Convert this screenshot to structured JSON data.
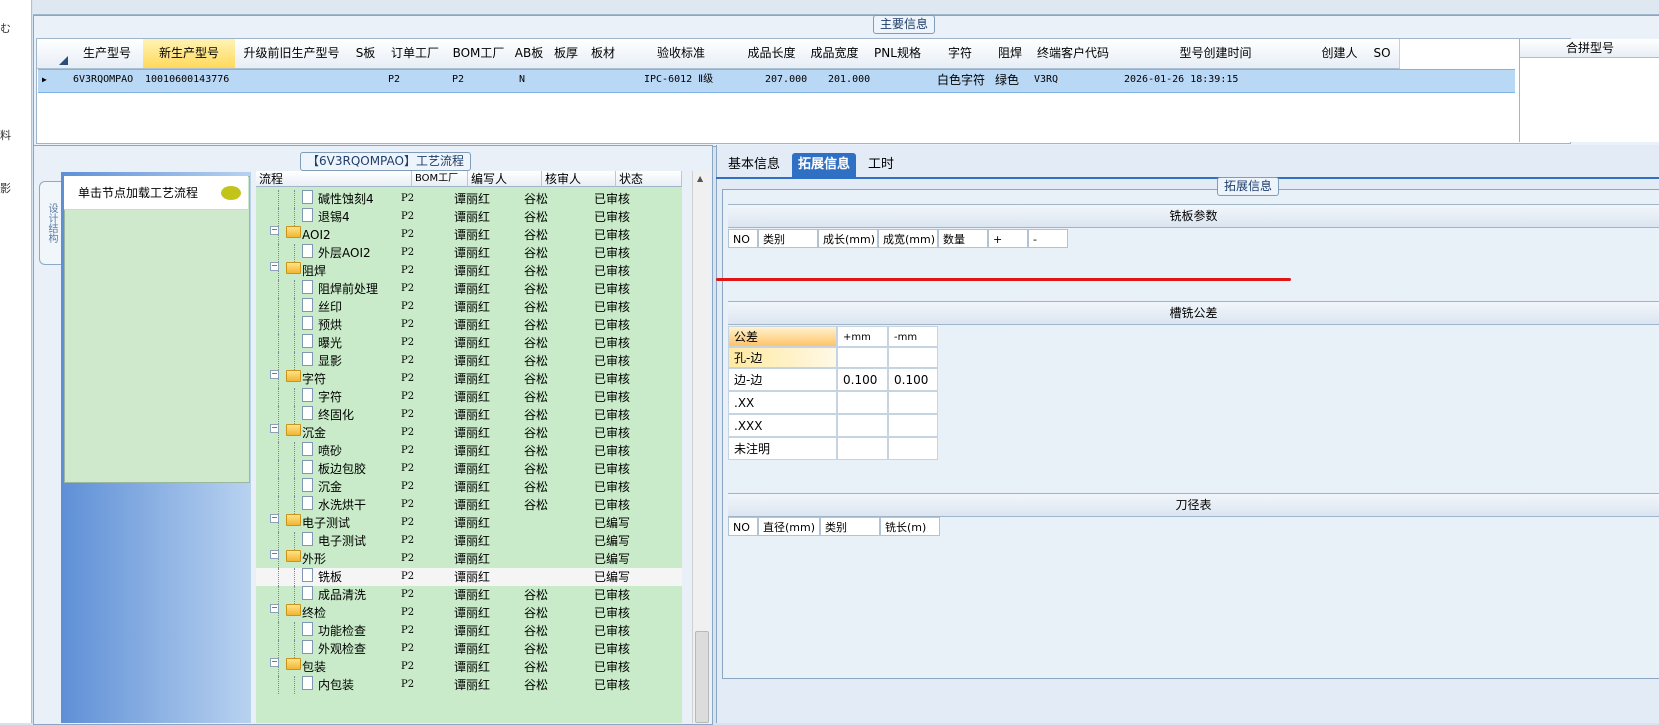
{
  "left_strip": {
    "chars": [
      "む",
      "料",
      "影"
    ]
  },
  "main_info": {
    "title": "主要信息",
    "columns": [
      "生产型号",
      "新生产型号",
      "升级前旧生产型号",
      "S板",
      "订单工厂",
      "BOM工厂",
      "AB板",
      "板厚",
      "板材",
      "验收标准",
      "成品长度",
      "成品宽度",
      "PNL规格",
      "字符",
      "阻焊",
      "终端客户代码",
      "型号创建时间",
      "创建人",
      "SO"
    ],
    "row": {
      "prod_model": "6V3RQOMPAO",
      "new_prod_model": "10010600143776",
      "order_factory": "P2",
      "bom_factory": "P2",
      "ab": "N",
      "standard": "IPC-6012 Ⅱ级",
      "length": "207.000",
      "width": "201.000",
      "char": "白色字符",
      "solder": "绿色",
      "customer_code": "V3RQ",
      "created": "2026-01-26 18:39:15"
    },
    "merge_header": "合拼型号"
  },
  "process": {
    "title": "【6V3RQOMPAO】工艺流程",
    "side_tab": "设计结构",
    "node_hint": "单击节点加载工艺流程",
    "columns": {
      "flow": "流程",
      "factory": "BOM工厂",
      "writer": "编写人",
      "reviewer": "核审人",
      "status": "状态"
    },
    "rows": [
      {
        "name": "碱性蚀刻4",
        "type": "doc",
        "factory": "P2",
        "writer": "谭丽红",
        "reviewer": "谷松",
        "status": "已审核"
      },
      {
        "name": "退锡4",
        "type": "doc",
        "factory": "P2",
        "writer": "谭丽红",
        "reviewer": "谷松",
        "status": "已审核"
      },
      {
        "name": "AOI2",
        "type": "folder",
        "factory": "P2",
        "writer": "谭丽红",
        "reviewer": "谷松",
        "status": "已审核"
      },
      {
        "name": "外层AOI2",
        "type": "doc",
        "factory": "P2",
        "writer": "谭丽红",
        "reviewer": "谷松",
        "status": "已审核"
      },
      {
        "name": "阻焊",
        "type": "folder",
        "factory": "P2",
        "writer": "谭丽红",
        "reviewer": "谷松",
        "status": "已审核"
      },
      {
        "name": "阻焊前处理",
        "type": "doc",
        "factory": "P2",
        "writer": "谭丽红",
        "reviewer": "谷松",
        "status": "已审核"
      },
      {
        "name": "丝印",
        "type": "doc",
        "factory": "P2",
        "writer": "谭丽红",
        "reviewer": "谷松",
        "status": "已审核"
      },
      {
        "name": "预烘",
        "type": "doc",
        "factory": "P2",
        "writer": "谭丽红",
        "reviewer": "谷松",
        "status": "已审核"
      },
      {
        "name": "曝光",
        "type": "doc",
        "factory": "P2",
        "writer": "谭丽红",
        "reviewer": "谷松",
        "status": "已审核"
      },
      {
        "name": "显影",
        "type": "doc",
        "factory": "P2",
        "writer": "谭丽红",
        "reviewer": "谷松",
        "status": "已审核"
      },
      {
        "name": "字符",
        "type": "folder",
        "factory": "P2",
        "writer": "谭丽红",
        "reviewer": "谷松",
        "status": "已审核"
      },
      {
        "name": "字符",
        "type": "doc",
        "factory": "P2",
        "writer": "谭丽红",
        "reviewer": "谷松",
        "status": "已审核"
      },
      {
        "name": "终固化",
        "type": "doc",
        "factory": "P2",
        "writer": "谭丽红",
        "reviewer": "谷松",
        "status": "已审核"
      },
      {
        "name": "沉金",
        "type": "folder",
        "factory": "P2",
        "writer": "谭丽红",
        "reviewer": "谷松",
        "status": "已审核"
      },
      {
        "name": "喷砂",
        "type": "doc",
        "factory": "P2",
        "writer": "谭丽红",
        "reviewer": "谷松",
        "status": "已审核"
      },
      {
        "name": "板边包胶",
        "type": "doc",
        "factory": "P2",
        "writer": "谭丽红",
        "reviewer": "谷松",
        "status": "已审核"
      },
      {
        "name": "沉金",
        "type": "doc",
        "factory": "P2",
        "writer": "谭丽红",
        "reviewer": "谷松",
        "status": "已审核"
      },
      {
        "name": "水洗烘干",
        "type": "doc",
        "factory": "P2",
        "writer": "谭丽红",
        "reviewer": "谷松",
        "status": "已审核"
      },
      {
        "name": "电子测试",
        "type": "folder",
        "factory": "P2",
        "writer": "谭丽红",
        "reviewer": "",
        "status": "已编写"
      },
      {
        "name": "电子测试",
        "type": "doc",
        "factory": "P2",
        "writer": "谭丽红",
        "reviewer": "",
        "status": "已编写"
      },
      {
        "name": "外形",
        "type": "folder",
        "factory": "P2",
        "writer": "谭丽红",
        "reviewer": "",
        "status": "已编写"
      },
      {
        "name": "铣板",
        "type": "doc",
        "factory": "P2",
        "writer": "谭丽红",
        "reviewer": "",
        "status": "已编写",
        "selected": true
      },
      {
        "name": "成品清洗",
        "type": "doc",
        "factory": "P2",
        "writer": "谭丽红",
        "reviewer": "谷松",
        "status": "已审核"
      },
      {
        "name": "终检",
        "type": "folder",
        "factory": "P2",
        "writer": "谭丽红",
        "reviewer": "谷松",
        "status": "已审核"
      },
      {
        "name": "功能检查",
        "type": "doc",
        "factory": "P2",
        "writer": "谭丽红",
        "reviewer": "谷松",
        "status": "已审核"
      },
      {
        "name": "外观检查",
        "type": "doc",
        "factory": "P2",
        "writer": "谭丽红",
        "reviewer": "谷松",
        "status": "已审核"
      },
      {
        "name": "包装",
        "type": "folder",
        "factory": "P2",
        "writer": "谭丽红",
        "reviewer": "谷松",
        "status": "已审核"
      },
      {
        "name": "内包装",
        "type": "doc",
        "factory": "P2",
        "writer": "谭丽红",
        "reviewer": "谷松",
        "status": "已审核"
      }
    ]
  },
  "tabs": [
    "基本信息",
    "拓展信息",
    "工时"
  ],
  "active_tab": "拓展信息",
  "ext": {
    "title": "拓展信息",
    "mill_params": {
      "title": "铣板参数",
      "columns": [
        "NO",
        "类别",
        "成长(mm)",
        "成宽(mm)",
        "数量",
        "+",
        "-"
      ]
    },
    "tolerance": {
      "title": "槽铣公差",
      "columns": [
        "公差",
        "+mm",
        "-mm"
      ],
      "rows": [
        {
          "name": "孔-边",
          "plus": "",
          "minus": ""
        },
        {
          "name": "边-边",
          "plus": "0.100",
          "minus": "0.100"
        },
        {
          "name": ".XX",
          "plus": "",
          "minus": ""
        },
        {
          "name": ".XXX",
          "plus": "",
          "minus": ""
        },
        {
          "name": "未注明",
          "plus": "",
          "minus": ""
        }
      ]
    },
    "tools": {
      "title": "刀径表",
      "columns": [
        "NO",
        "直径(mm)",
        "类别",
        "铣长(m)"
      ]
    }
  }
}
